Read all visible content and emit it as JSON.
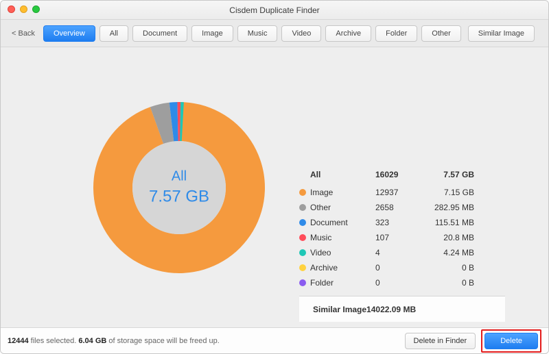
{
  "window": {
    "title": "Cisdem Duplicate Finder"
  },
  "toolbar": {
    "back": "< Back",
    "tabs": [
      "Overview",
      "All",
      "Document",
      "Image",
      "Music",
      "Video",
      "Archive",
      "Folder",
      "Other",
      "Similar Image"
    ]
  },
  "chart_data": {
    "type": "pie",
    "title": "All",
    "center_label": "All",
    "center_value": "7.57 GB",
    "series": [
      {
        "name": "Image",
        "count": 12937,
        "size": "7.15 GB",
        "bytes": 7677804544,
        "color": "#f59a3e"
      },
      {
        "name": "Other",
        "count": 2658,
        "size": "282.95 MB",
        "bytes": 296695808,
        "color": "#9e9e9e"
      },
      {
        "name": "Document",
        "count": 323,
        "size": "115.51 MB",
        "bytes": 121122652,
        "color": "#2f8be8"
      },
      {
        "name": "Music",
        "count": 107,
        "size": "20.8 MB",
        "bytes": 21810380,
        "color": "#ff4d5a"
      },
      {
        "name": "Video",
        "count": 4,
        "size": "4.24 MB",
        "bytes": 4445962,
        "color": "#1fc7b6"
      },
      {
        "name": "Archive",
        "count": 0,
        "size": "0 B",
        "bytes": 0,
        "color": "#ffd23f"
      },
      {
        "name": "Folder",
        "count": 0,
        "size": "0 B",
        "bytes": 0,
        "color": "#8a5cf0"
      }
    ],
    "totals": {
      "label": "All",
      "count": 16029,
      "size": "7.57 GB"
    },
    "similar": {
      "label": "Similar Image",
      "count": 140,
      "size": "22.09 MB"
    }
  },
  "footer": {
    "selected_count": "12444",
    "status_mid": " files selected. ",
    "freed_size": "6.04 GB",
    "status_tail": " of storage space will be freed up.",
    "delete_in_finder": "Delete in Finder",
    "delete": "Delete"
  }
}
